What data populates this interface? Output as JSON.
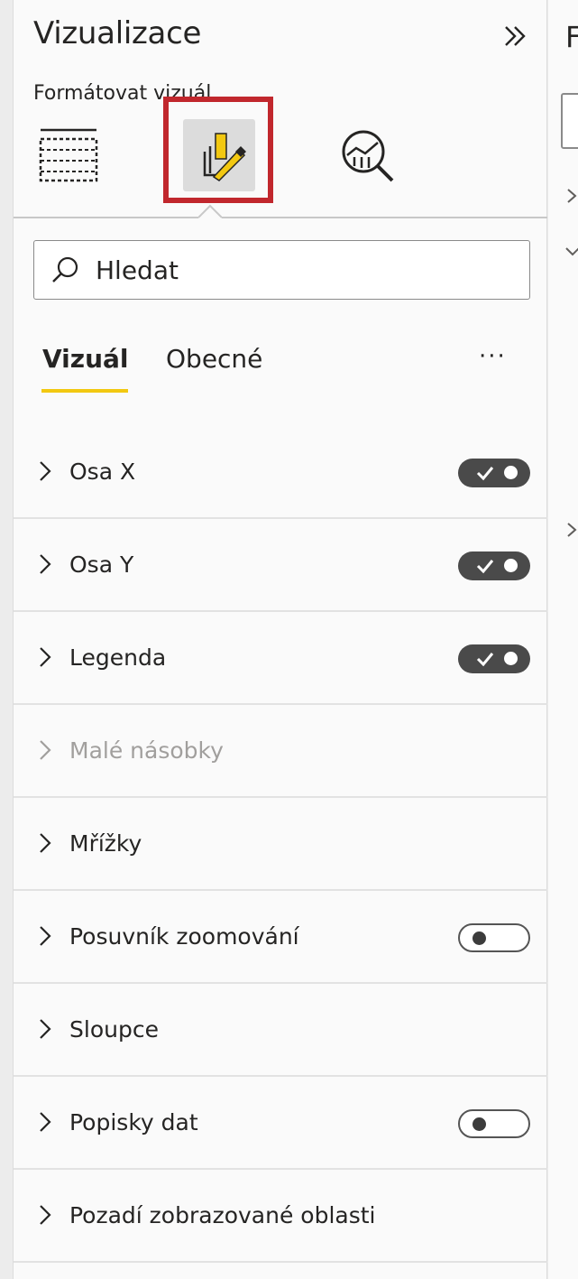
{
  "pane": {
    "title": "Vizualizace",
    "subtitle": "Formátovat vizuál"
  },
  "tabs": [
    {
      "icon": "table-fields-icon",
      "selected": false
    },
    {
      "icon": "format-paintbrush-icon",
      "selected": true
    },
    {
      "icon": "analytics-magnifier-icon",
      "selected": false
    }
  ],
  "search": {
    "placeholder": "Hledat"
  },
  "subtabs": {
    "visual": "Vizuál",
    "general": "Obecné",
    "more": "···"
  },
  "sections": [
    {
      "label": "Osa X",
      "toggle": "on",
      "disabled": false
    },
    {
      "label": "Osa Y",
      "toggle": "on",
      "disabled": false
    },
    {
      "label": "Legenda",
      "toggle": "on",
      "disabled": false
    },
    {
      "label": "Malé násobky",
      "toggle": null,
      "disabled": true
    },
    {
      "label": "Mřížky",
      "toggle": null,
      "disabled": false
    },
    {
      "label": "Posuvník zoomování",
      "toggle": "off",
      "disabled": false
    },
    {
      "label": "Sloupce",
      "toggle": null,
      "disabled": false
    },
    {
      "label": "Popisky dat",
      "toggle": "off",
      "disabled": false
    },
    {
      "label": "Pozadí zobrazované oblasti",
      "toggle": null,
      "disabled": false
    }
  ],
  "colors": {
    "accent": "#f2c811",
    "highlight_box": "#c1272d",
    "toggle_on": "#4a4a4a"
  },
  "right_panel": {
    "title_fragment": "F"
  }
}
